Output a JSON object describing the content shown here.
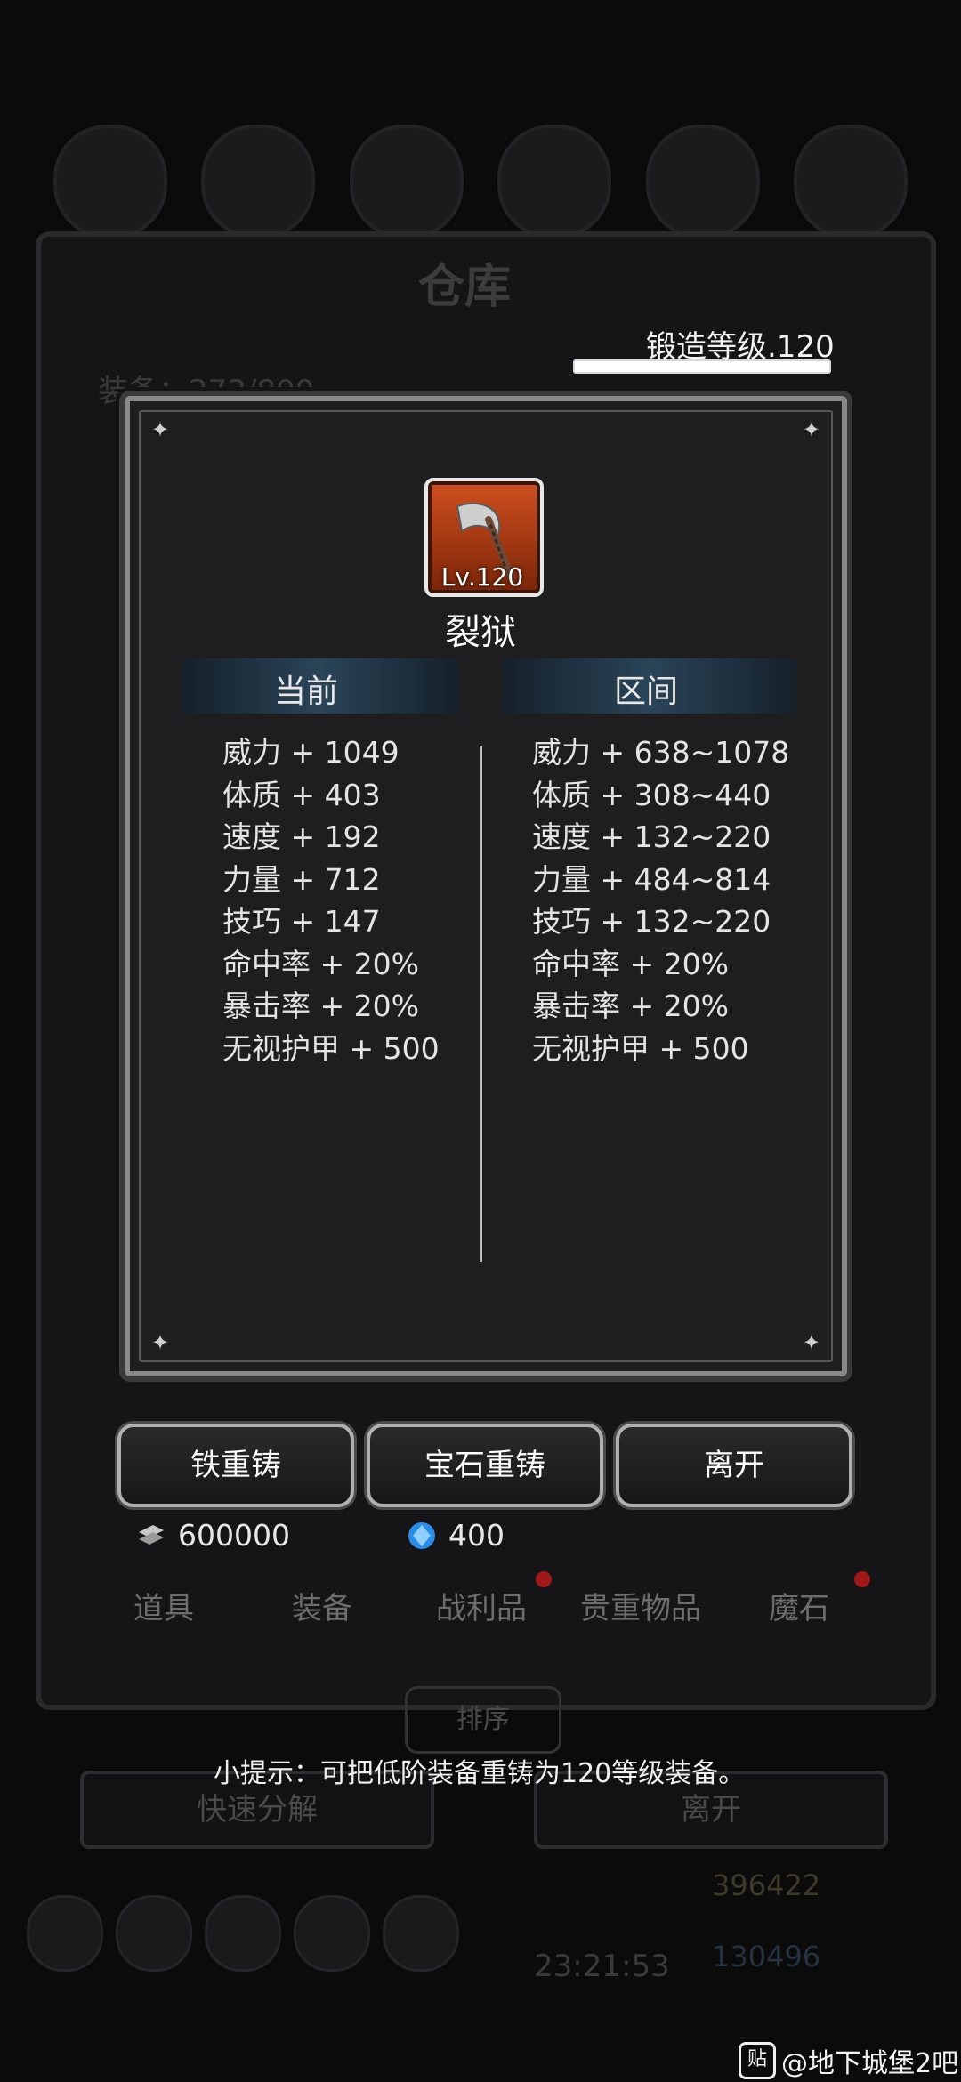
{
  "background": {
    "title": "仓库",
    "equip_count": "装备：273/800",
    "sort_label": "排序",
    "quick_dismantle": "快速分解",
    "leave": "离开",
    "gold": "396422",
    "gems": "130496",
    "timer": "23:21:53"
  },
  "forge": {
    "level_label": "锻造等级.120",
    "progress": 1.0
  },
  "item": {
    "icon": "axe-icon",
    "level": "Lv.120",
    "name": "裂狱"
  },
  "columns": {
    "current_header": "当前",
    "range_header": "区间"
  },
  "current_stats": [
    "威力 + 1049",
    "体质 + 403",
    "速度 + 192",
    "力量 + 712",
    "技巧 + 147",
    "命中率 + 20%",
    "暴击率 + 20%",
    "无视护甲 + 500"
  ],
  "range_stats": [
    "威力 + 638~1078",
    "体质 + 308~440",
    "速度 + 132~220",
    "力量 + 484~814",
    "技巧 + 132~220",
    "命中率 + 20%",
    "暴击率 + 20%",
    "无视护甲 + 500"
  ],
  "actions": {
    "iron_reforge": "铁重铸",
    "gem_reforge": "宝石重铸",
    "leave": "离开"
  },
  "currency": {
    "iron_amount": "600000",
    "gem_amount": "400"
  },
  "tabs": [
    "道具",
    "装备",
    "战利品",
    "贵重物品",
    "魔石"
  ],
  "tip": "小提示：可把低阶装备重铸为120等级装备。",
  "watermark": "@地下城堡2吧",
  "colors": {
    "accent_blue": "#2a4458",
    "item_bg": "#d0501f",
    "badge_red": "#a11818"
  }
}
